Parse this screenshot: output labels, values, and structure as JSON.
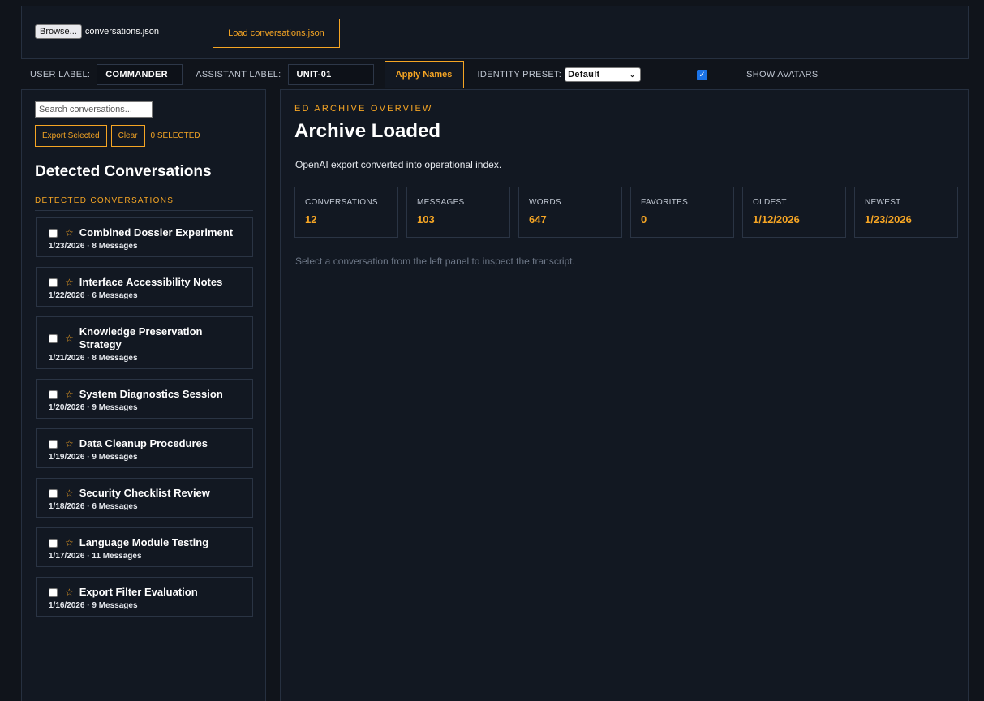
{
  "filebar": {
    "browse_label": "Browse...",
    "file_name": "conversations.json",
    "load_label": "Load conversations.json"
  },
  "toolbar": {
    "user_label": "USER LABEL:",
    "user_value": "COMMANDER",
    "assistant_label": "ASSISTANT LABEL:",
    "assistant_value": "UNIT-01",
    "apply_label": "Apply Names",
    "preset_label": "IDENTITY PRESET:",
    "preset_value": "Default",
    "show_avatars_label": "SHOW AVATARS",
    "show_avatars_checked": true
  },
  "sidebar": {
    "search_placeholder": "Search conversations...",
    "export_label": "Export Selected",
    "clear_label": "Clear",
    "selected_count": "0 SELECTED",
    "title": "Detected Conversations",
    "subtitle": "DETECTED CONVERSATIONS",
    "items": [
      {
        "title": "Combined Dossier Experiment",
        "meta": "1/23/2026 · 8 Messages"
      },
      {
        "title": "Interface Accessibility Notes",
        "meta": "1/22/2026 · 6 Messages"
      },
      {
        "title": "Knowledge Preservation Strategy",
        "meta": "1/21/2026 · 8 Messages"
      },
      {
        "title": "System Diagnostics Session",
        "meta": "1/20/2026 · 9 Messages"
      },
      {
        "title": "Data Cleanup Procedures",
        "meta": "1/19/2026 · 9 Messages"
      },
      {
        "title": "Security Checklist Review",
        "meta": "1/18/2026 · 6 Messages"
      },
      {
        "title": "Language Module Testing",
        "meta": "1/17/2026 · 11 Messages"
      },
      {
        "title": "Export Filter Evaluation",
        "meta": "1/16/2026 · 9 Messages"
      }
    ]
  },
  "main": {
    "eyebrow": "ED ARCHIVE OVERVIEW",
    "title": "Archive Loaded",
    "description": "OpenAI export converted into operational index.",
    "stats": [
      {
        "label": "CONVERSATIONS",
        "value": "12"
      },
      {
        "label": "MESSAGES",
        "value": "103"
      },
      {
        "label": "WORDS",
        "value": "647"
      },
      {
        "label": "FAVORITES",
        "value": "0"
      },
      {
        "label": "OLDEST",
        "value": "1/12/2026"
      },
      {
        "label": "NEWEST",
        "value": "1/23/2026"
      }
    ],
    "hint": "Select a conversation from the left panel to inspect the transcript."
  },
  "colors": {
    "accent": "#f5a524",
    "background": "#10141b",
    "panel": "#121822",
    "border": "#263040"
  },
  "icons": {
    "favorite": "star-outline-icon",
    "dropdown": "chevron-down-icon",
    "checkbox": "checkbox-icon"
  }
}
